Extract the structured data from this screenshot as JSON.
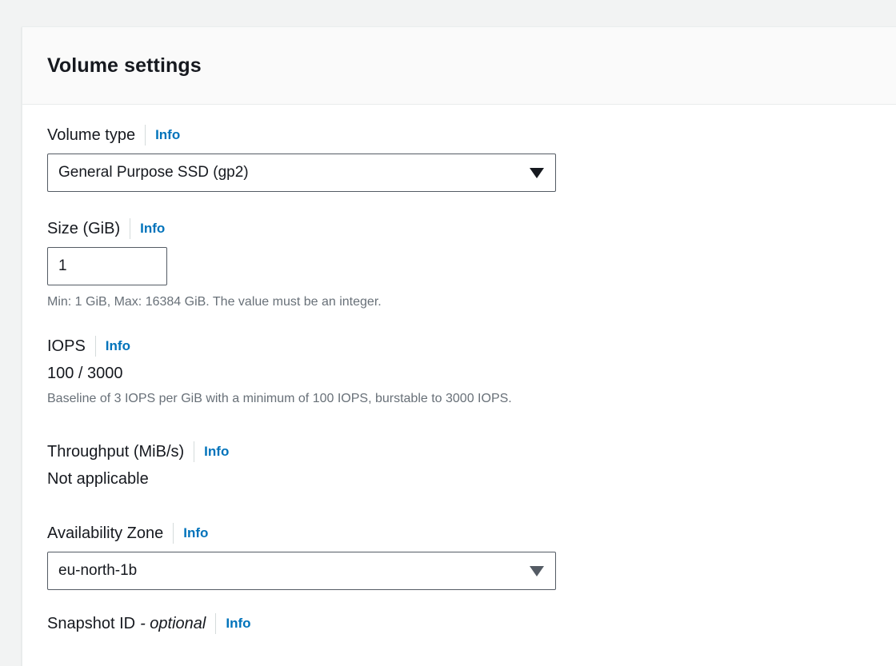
{
  "panel": {
    "title": "Volume settings"
  },
  "info_label": "Info",
  "volume_type": {
    "label": "Volume type",
    "selected": "General Purpose SSD (gp2)"
  },
  "size": {
    "label": "Size (GiB)",
    "value": "1",
    "hint": "Min: 1 GiB, Max: 16384 GiB. The value must be an integer."
  },
  "iops": {
    "label": "IOPS",
    "value": "100 / 3000",
    "hint": "Baseline of 3 IOPS per GiB with a minimum of 100 IOPS, burstable to 3000 IOPS."
  },
  "throughput": {
    "label": "Throughput (MiB/s)",
    "value": "Not applicable"
  },
  "availability_zone": {
    "label": "Availability Zone",
    "selected": "eu-north-1b"
  },
  "snapshot": {
    "label": "Snapshot ID",
    "optional": "- optional"
  },
  "colors": {
    "link": "#0073bb",
    "border": "#545b64",
    "hint": "#687078",
    "text": "#16191f"
  }
}
